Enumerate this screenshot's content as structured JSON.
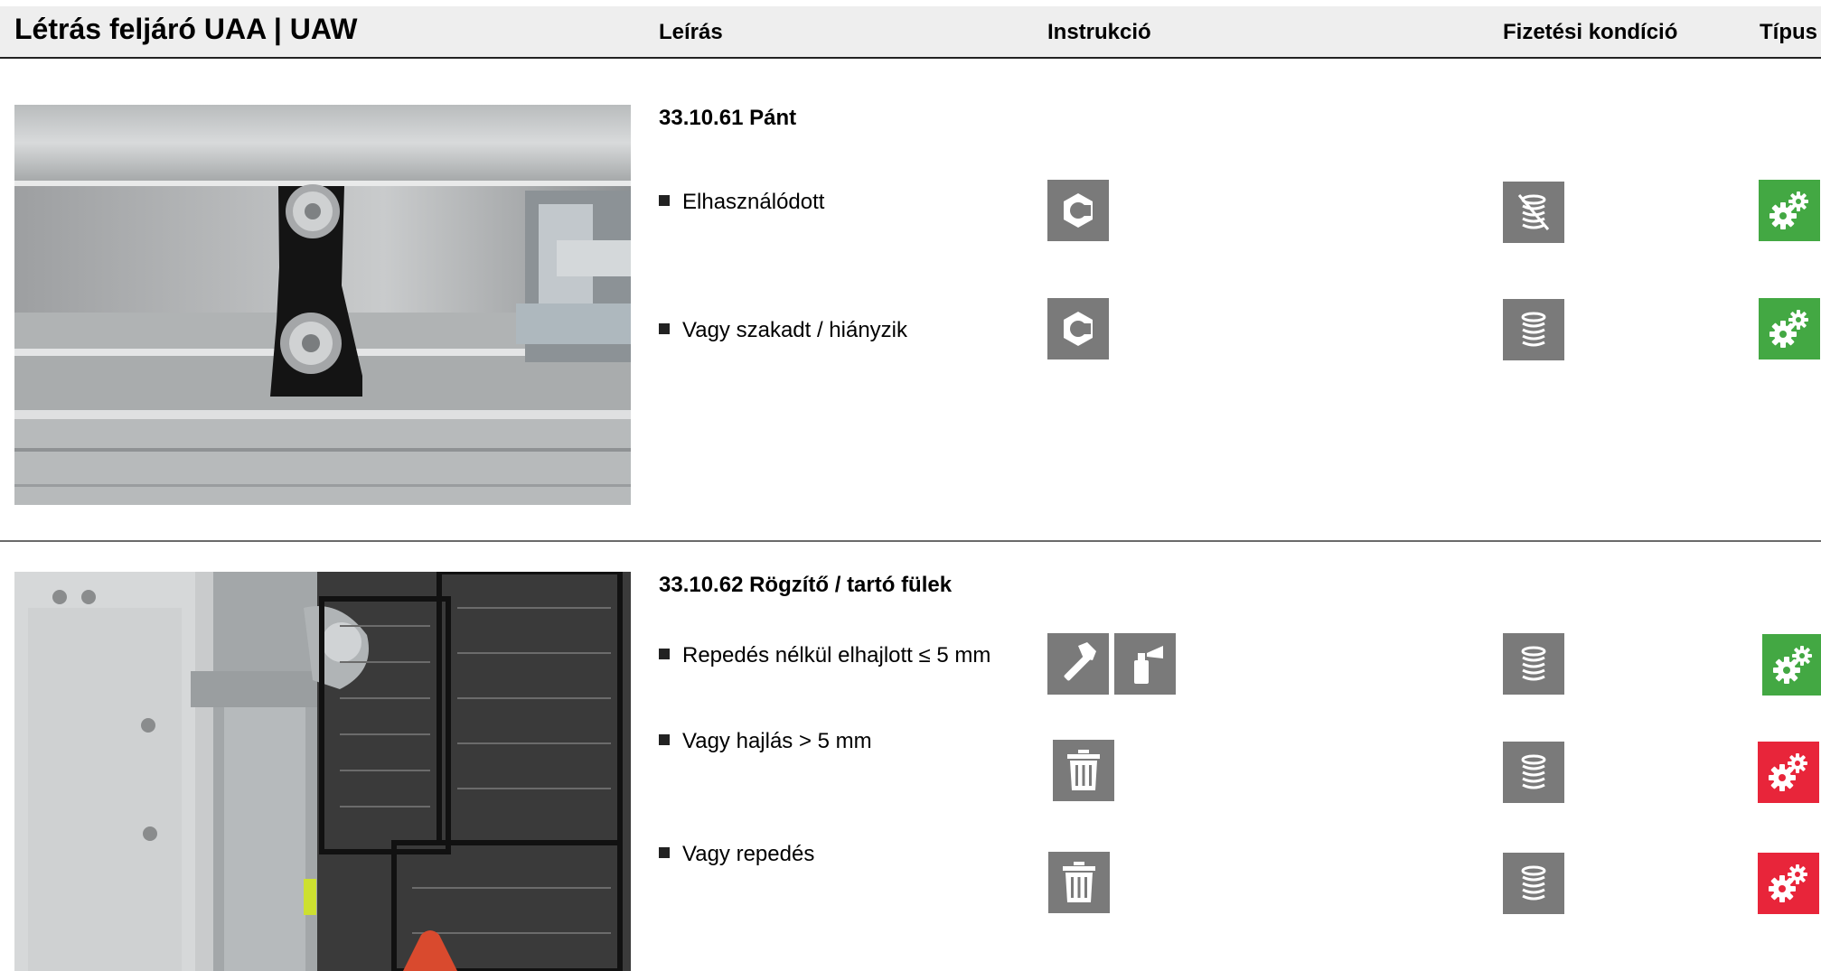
{
  "header": {
    "title": "Létrás feljáró UAA | UAW",
    "col_description": "Leírás",
    "col_instruction": "Instrukció",
    "col_payment": "Fizetési kondíció",
    "col_type": "Típus"
  },
  "sections": [
    {
      "title": "33.10.61 Pánt",
      "photo_icon": "ladder-hinge-strap-photo",
      "rows": [
        {
          "text": "Elhasználódott",
          "instruction_icons": [
            "nut-icon"
          ],
          "payment_icon": "coins-crossed-icon",
          "type_icon": "gears-icon",
          "type_color": "#43a843"
        },
        {
          "text": "Vagy szakadt / hiányzik",
          "instruction_icons": [
            "nut-icon"
          ],
          "payment_icon": "coins-icon",
          "type_icon": "gears-icon",
          "type_color": "#43a843"
        }
      ]
    },
    {
      "title": "33.10.62 Rögzítő / tartó fülek",
      "photo_icon": "ladder-claw-photo",
      "rows": [
        {
          "text": "Repedés nélkül elhajlott ≤ 5 mm",
          "instruction_icons": [
            "hammer-icon",
            "spray-can-icon"
          ],
          "payment_icon": "coins-icon",
          "type_icon": "gears-icon",
          "type_color": "#43a843"
        },
        {
          "text": "Vagy hajlás > 5 mm",
          "instruction_icons": [
            "trash-icon"
          ],
          "payment_icon": "coins-icon",
          "type_icon": "gears-icon",
          "type_color": "#e8253a"
        },
        {
          "text": "Vagy repedés",
          "instruction_icons": [
            "trash-icon"
          ],
          "payment_icon": "coins-icon",
          "type_icon": "gears-icon",
          "type_color": "#e8253a"
        }
      ]
    }
  ],
  "colors": {
    "tile_gray": "#7a7a7a",
    "green": "#43a843",
    "red": "#e8253a"
  }
}
